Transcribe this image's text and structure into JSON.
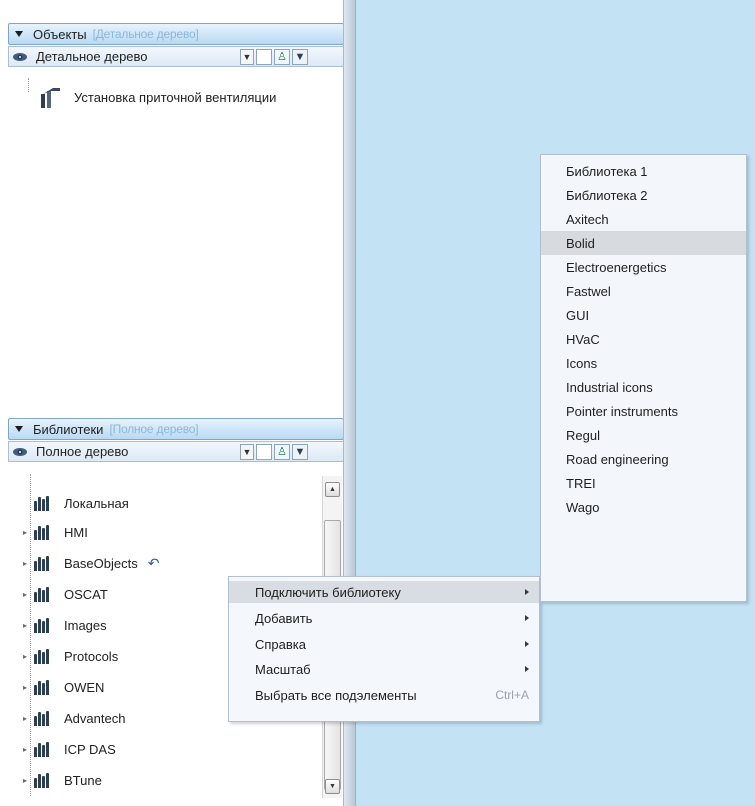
{
  "objects_panel": {
    "header_title": "Объекты",
    "header_subtitle": "[Детальное дерево]",
    "view_mode": "Детальное дерево",
    "tree": [
      {
        "label": "Установка приточной вентиляции"
      }
    ]
  },
  "libraries_panel": {
    "header_title": "Библиотеки",
    "header_subtitle": "[Полное дерево]",
    "view_mode": "Полное дерево",
    "items": [
      {
        "label": "Локальная",
        "expandable": false
      },
      {
        "label": "HMI",
        "expandable": true
      },
      {
        "label": "BaseObjects",
        "expandable": true
      },
      {
        "label": "OSCAT",
        "expandable": true
      },
      {
        "label": "Images",
        "expandable": true
      },
      {
        "label": "Protocols",
        "expandable": true
      },
      {
        "label": "OWEN",
        "expandable": true
      },
      {
        "label": "Advantech",
        "expandable": true
      },
      {
        "label": "ICP DAS",
        "expandable": true
      },
      {
        "label": "BTune",
        "expandable": true
      }
    ]
  },
  "context_menu": {
    "items": [
      {
        "label": "Подключить библиотеку",
        "submenu": true,
        "highlighted": true,
        "shortcut": ""
      },
      {
        "label": "Добавить",
        "submenu": true,
        "highlighted": false,
        "shortcut": ""
      },
      {
        "label": "Справка",
        "submenu": true,
        "highlighted": false,
        "shortcut": ""
      },
      {
        "label": "Масштаб",
        "submenu": true,
        "highlighted": false,
        "shortcut": ""
      },
      {
        "label": "Выбрать все подэлементы",
        "submenu": false,
        "highlighted": false,
        "shortcut": "Ctrl+A"
      }
    ]
  },
  "submenu": {
    "highlighted_index": 3,
    "items": [
      "Библиотека 1",
      "Библиотека 2",
      "Axitech",
      "Bolid",
      "Electroenergetics",
      "Fastwel",
      "GUI",
      "HVaC",
      "Icons",
      "Industrial icons",
      "Pointer instruments",
      "Regul",
      "Road engineering",
      "TREI",
      "Wago"
    ]
  },
  "colors": {
    "workspace": "#c3e3f4",
    "header_gradient_end": "#b9daf3",
    "menu_highlight": "#d8dde3"
  }
}
